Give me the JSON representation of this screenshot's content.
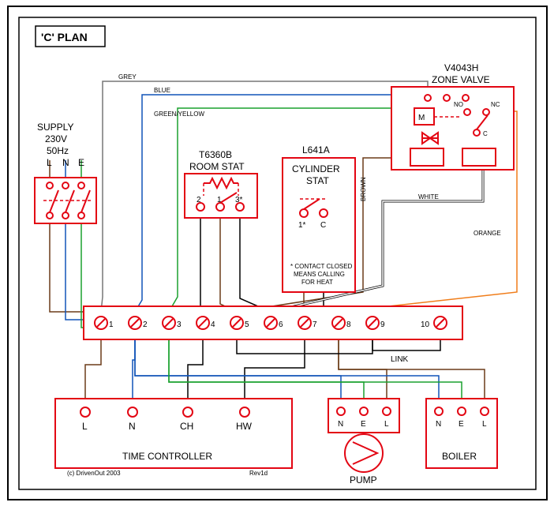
{
  "title": "'C' PLAN",
  "supply": {
    "label": "SUPPLY",
    "voltage": "230V",
    "freq": "50Hz",
    "terminals": [
      "L",
      "N",
      "E"
    ]
  },
  "room_stat": {
    "model": "T6360B",
    "label": "ROOM STAT",
    "pins": [
      "2",
      "1",
      "3*"
    ]
  },
  "cyl_stat": {
    "model": "L641A",
    "label1": "CYLINDER",
    "label2": "STAT",
    "pins": [
      "1*",
      "C"
    ],
    "note1": "* CONTACT CLOSED",
    "note2": "MEANS CALLING",
    "note3": "FOR HEAT"
  },
  "zone_valve": {
    "model": "V4043H",
    "label": "ZONE VALVE",
    "m": "M",
    "no": "NO",
    "nc": "NC",
    "c": "C"
  },
  "terminal_strip": {
    "pins": [
      "1",
      "2",
      "3",
      "4",
      "5",
      "6",
      "7",
      "8",
      "9",
      "10"
    ],
    "link_label": "LINK"
  },
  "time_controller": {
    "label": "TIME CONTROLLER",
    "pins": [
      "L",
      "N",
      "CH",
      "HW"
    ]
  },
  "pump": {
    "label": "PUMP",
    "pins": [
      "N",
      "E",
      "L"
    ]
  },
  "boiler": {
    "label": "BOILER",
    "pins": [
      "N",
      "E",
      "L"
    ]
  },
  "wire_labels": {
    "grey": "GREY",
    "blue": "BLUE",
    "greenyellow": "GREEN/YELLOW",
    "brown": "BROWN",
    "white": "WHITE",
    "orange": "ORANGE"
  },
  "footer": {
    "copyright": "(c) DrivenOut 2003",
    "rev": "Rev1d"
  }
}
